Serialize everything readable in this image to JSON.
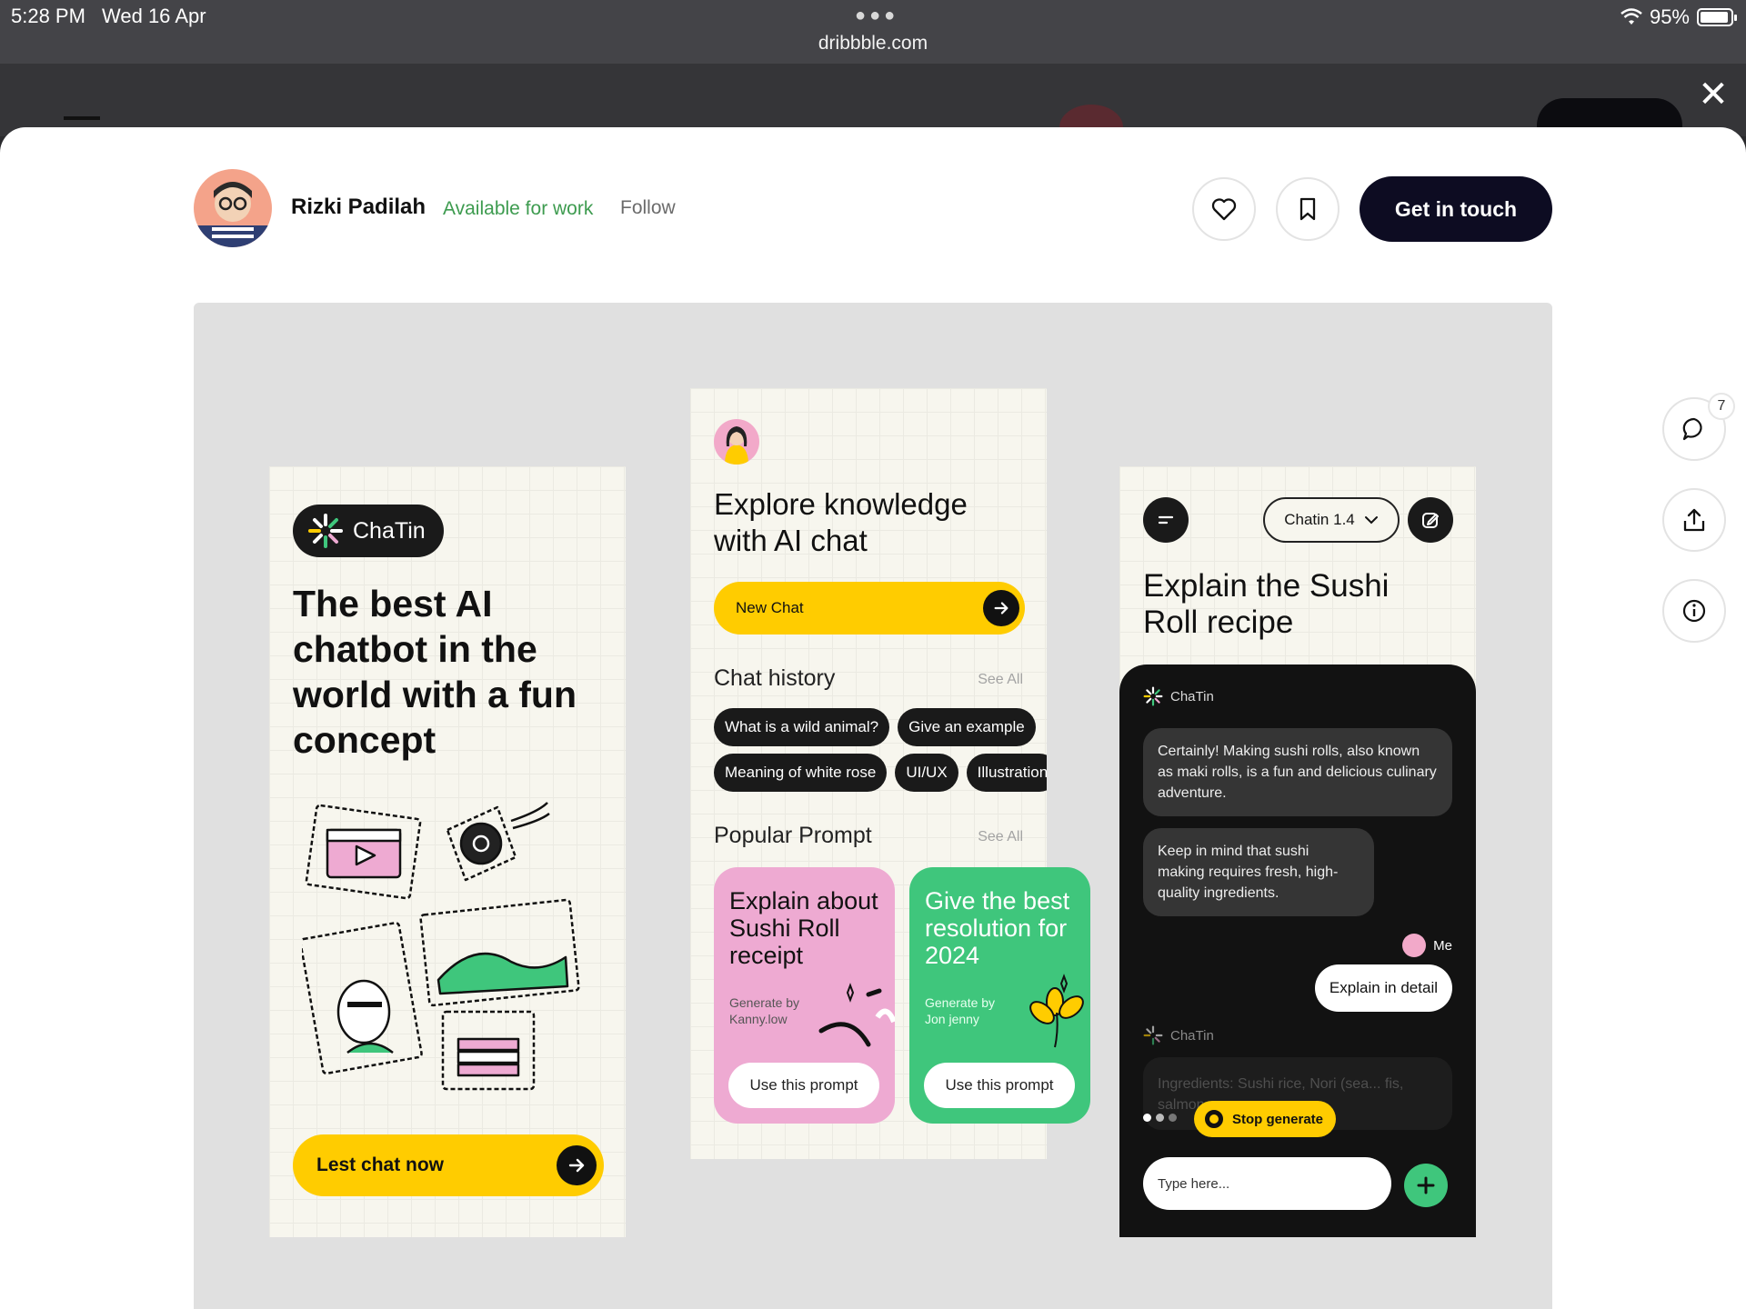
{
  "status_bar": {
    "time": "5:28 PM",
    "date": "Wed 16 Apr",
    "url": "dribbble.com",
    "battery": "95%",
    "battery_level": 0.95
  },
  "header": {
    "author": "Rizki Padilah",
    "availability": "Available for work",
    "follow_label": "Follow",
    "cta_label": "Get in touch"
  },
  "side_actions": {
    "comment_count": "7"
  },
  "shot": {
    "panel1": {
      "brand": "ChaTin",
      "headline": "The best AI chatbot in the world with a fun concept",
      "cta": "Lest chat now"
    },
    "panel2": {
      "title": "Explore knowledge with AI chat",
      "new_chat": "New Chat",
      "chat_history_title": "Chat history",
      "see_all": "See All",
      "history_row1": [
        "What is a wild animal?",
        "Give an example"
      ],
      "history_row2": [
        "Meaning of white rose",
        "UI/UX",
        "Illustration"
      ],
      "popular_title": "Popular Prompt",
      "cards": [
        {
          "title": "Explain about Sushi Roll receipt",
          "generated_by": "Generate by Kanny.low",
          "button": "Use this prompt"
        },
        {
          "title": "Give the best resolution for 2024",
          "generated_by": "Generate by Jon jenny",
          "button": "Use this prompt"
        }
      ]
    },
    "panel3": {
      "model": "Chatin 1.4",
      "title": "Explain the Sushi Roll recipe",
      "bot_name": "ChaTin",
      "bot_messages": [
        "Certainly! Making sushi rolls, also known as maki rolls, is a fun and delicious culinary adventure.",
        "Keep in mind that sushi making requires fresh, high-quality ingredients."
      ],
      "me_label": "Me",
      "user_message": "Explain in detail",
      "faded_message": "Ingredients: Sushi rice, Nori (sea... fis, salmon.",
      "stop_label": "Stop generate",
      "input_placeholder": "Type here..."
    }
  },
  "colors": {
    "accent_yellow": "#ffcc00",
    "accent_green": "#3fc67c",
    "accent_pink": "#eeaad2",
    "dark": "#0d0c22"
  }
}
